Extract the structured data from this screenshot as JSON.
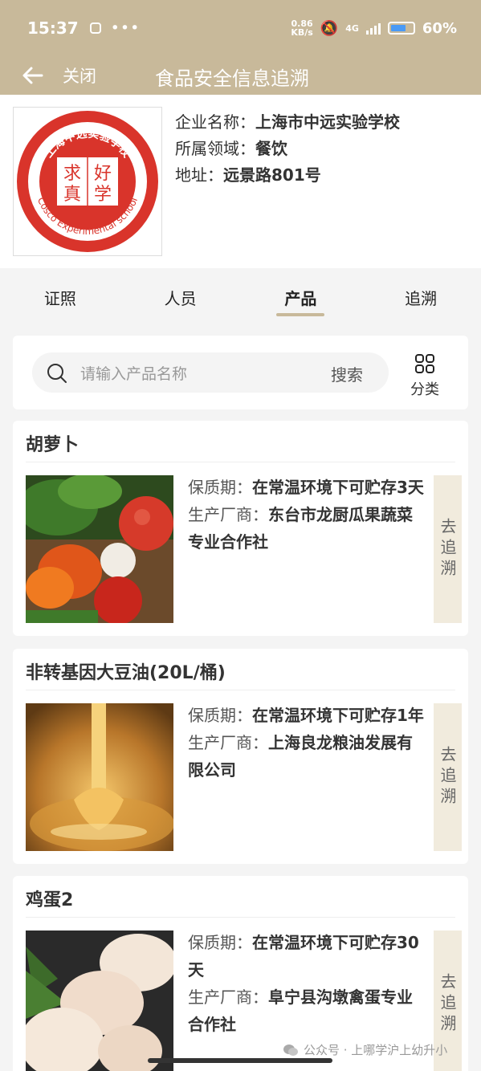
{
  "status_bar": {
    "time": "15:37",
    "net_speed_value": "0.86",
    "net_speed_unit": "KB/s",
    "network_type": "4G",
    "battery_percent": "60%",
    "battery_level": 0.6
  },
  "navbar": {
    "close_label": "关闭",
    "title": "食品安全信息追溯"
  },
  "company": {
    "name_label": "企业名称：",
    "name": "上海市中远实验学校",
    "domain_label": "所属领域：",
    "domain": "餐饮",
    "address_label": "地址：",
    "address": "远景路801号",
    "logo": {
      "ring_text_cn": "上海中远实验学校",
      "ring_text_en": "Cosco Experimental school",
      "center_text": [
        "求",
        "好",
        "真",
        "学"
      ]
    }
  },
  "tabs": [
    {
      "label": "证照",
      "active": false
    },
    {
      "label": "人员",
      "active": false
    },
    {
      "label": "产品",
      "active": true
    },
    {
      "label": "追溯",
      "active": false
    }
  ],
  "search": {
    "placeholder": "请输入产品名称",
    "button_label": "搜索",
    "category_label": "分类"
  },
  "products": [
    {
      "name": "胡萝卜",
      "shelf_label": "保质期：",
      "shelf_life": "在常温环境下可贮存3天",
      "maker_label": "生产厂商：",
      "maker": "东台市龙厨瓜果蔬菜专业合作社",
      "trace_label": "去追溯"
    },
    {
      "name": "非转基因大豆油(20L/桶)",
      "shelf_label": "保质期：",
      "shelf_life": "在常温环境下可贮存1年",
      "maker_label": "生产厂商：",
      "maker": "上海良龙粮油发展有限公司",
      "trace_label": "去追溯"
    },
    {
      "name": "鸡蛋2",
      "shelf_label": "保质期：",
      "shelf_life": "在常温环境下可贮存30天",
      "maker_label": "生产厂商：",
      "maker": "阜宁县沟墩禽蛋专业合作社",
      "trace_label": "去追溯"
    }
  ],
  "watermark": "公众号 · 上哪学沪上幼升小",
  "colors": {
    "header_bg": "#c8b99a",
    "trace_bg": "#f1ebdd",
    "logo_red": "#d9342b"
  }
}
